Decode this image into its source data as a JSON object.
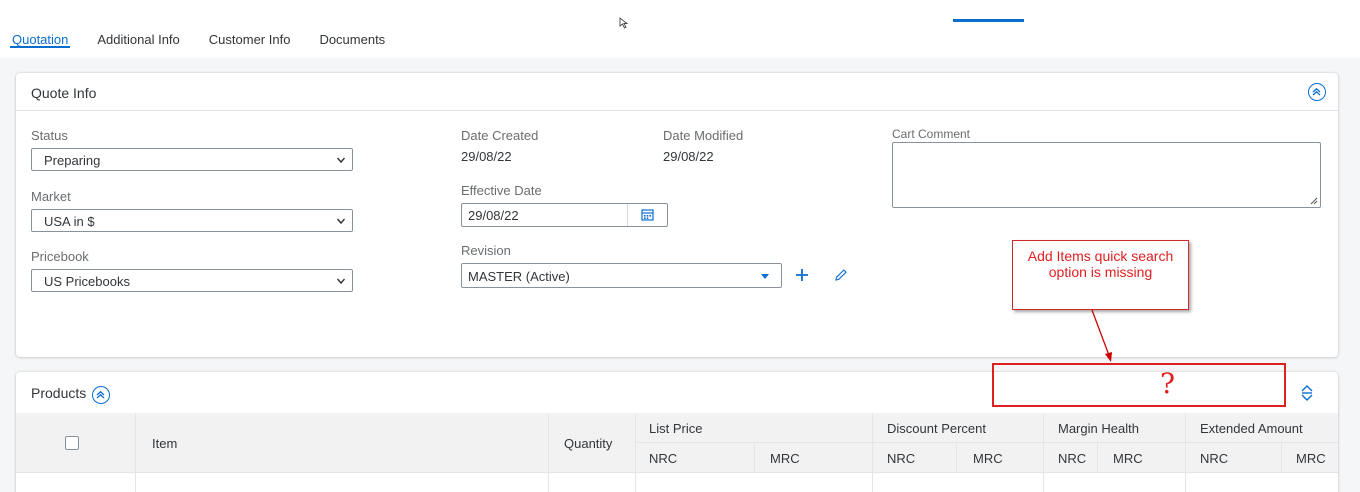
{
  "tabs": [
    {
      "label": "Quotation",
      "active": true
    },
    {
      "label": "Additional Info",
      "active": false
    },
    {
      "label": "Customer Info",
      "active": false
    },
    {
      "label": "Documents",
      "active": false
    }
  ],
  "quote_info": {
    "title": "Quote Info",
    "status": {
      "label": "Status",
      "value": "Preparing"
    },
    "market": {
      "label": "Market",
      "value": "USA in $"
    },
    "pricebook": {
      "label": "Pricebook",
      "value": "US Pricebooks"
    },
    "date_created": {
      "label": "Date Created",
      "value": "29/08/22"
    },
    "date_modified": {
      "label": "Date Modified",
      "value": "29/08/22"
    },
    "effective_date": {
      "label": "Effective Date",
      "value": "29/08/22"
    },
    "revision": {
      "label": "Revision",
      "value": "MASTER (Active)"
    },
    "cart_comment": {
      "label": "Cart Comment",
      "value": ""
    }
  },
  "annotation": {
    "callout_text": "Add Items quick search option is missing",
    "mark": "?"
  },
  "products": {
    "title": "Products",
    "columns": {
      "item": "Item",
      "quantity": "Quantity",
      "list_price": "List Price",
      "discount_percent": "Discount Percent",
      "margin_health": "Margin Health",
      "extended_amount": "Extended Amount",
      "nrc": "NRC",
      "mrc": "MRC"
    }
  },
  "colors": {
    "accent": "#0a6ed1",
    "annotation_red": "#e02020",
    "header_bg": "#f2f2f2"
  }
}
